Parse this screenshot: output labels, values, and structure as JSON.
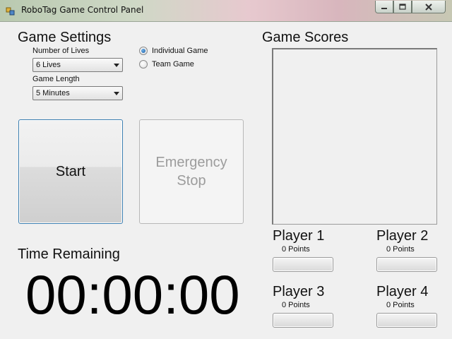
{
  "window": {
    "title": "RoboTag Game Control Panel",
    "controls": {
      "minimize": "minimize-icon",
      "maximize": "maximize-icon",
      "close": "close-icon"
    }
  },
  "settings": {
    "heading": "Game Settings",
    "lives_label": "Number of Lives",
    "lives_value": "6 Lives",
    "length_label": "Game Length",
    "length_value": "5 Minutes",
    "radio_individual": "Individual Game",
    "radio_team": "Team Game",
    "selected_mode": "Individual Game"
  },
  "actions": {
    "start": "Start",
    "emergency_stop": "Emergency\nStop"
  },
  "scores": {
    "heading": "Game Scores",
    "players": [
      {
        "name": "Player 1",
        "points": "0 Points",
        "progress": 0
      },
      {
        "name": "Player 2",
        "points": "0 Points",
        "progress": 0
      },
      {
        "name": "Player 3",
        "points": "0 Points",
        "progress": 0
      },
      {
        "name": "Player 4",
        "points": "0 Points",
        "progress": 0
      }
    ]
  },
  "timer": {
    "label": "Time Remaining",
    "value": "00:00:00"
  },
  "colors": {
    "accent": "#3c7fb1",
    "disabled_text": "#9c9c9c"
  }
}
